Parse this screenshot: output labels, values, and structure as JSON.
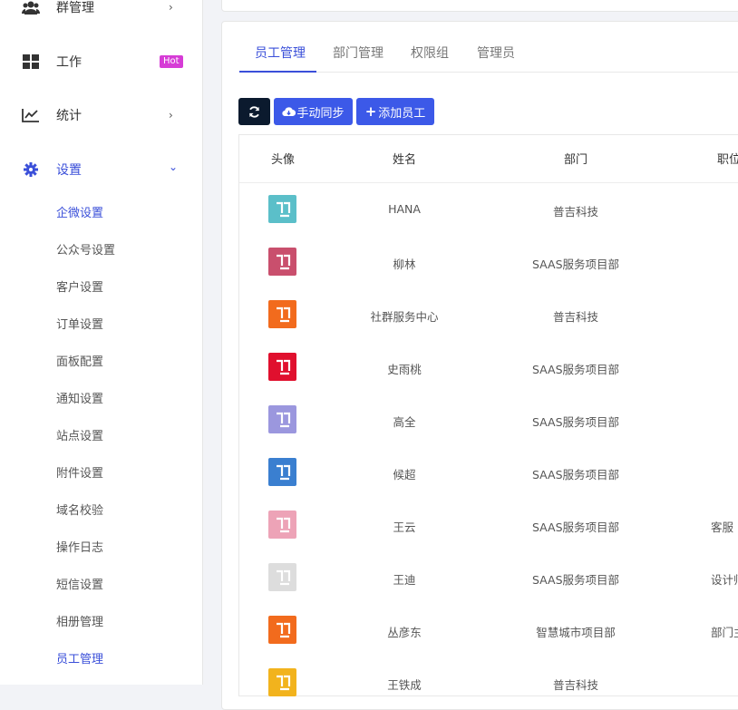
{
  "sidebar": {
    "items": [
      {
        "label": "群管理",
        "icon": "users-icon",
        "chevron": "›"
      },
      {
        "label": "工作",
        "icon": "grid-icon",
        "badge": "Hot"
      },
      {
        "label": "统计",
        "icon": "line-chart-icon",
        "chevron": "›"
      },
      {
        "label": "设置",
        "icon": "gear-icon",
        "chevron": "⌄"
      }
    ],
    "settings_submenu": [
      "企微设置",
      "公众号设置",
      "客户设置",
      "订单设置",
      "面板配置",
      "通知设置",
      "站点设置",
      "附件设置",
      "域名校验",
      "操作日志",
      "短信设置",
      "相册管理",
      "员工管理"
    ]
  },
  "tabs": [
    "员工管理",
    "部门管理",
    "权限组",
    "管理员"
  ],
  "toolbar": {
    "refresh_icon": "refresh-icon",
    "sync_label": "手动同步",
    "add_label": "添加员工"
  },
  "table": {
    "headers": [
      "头像",
      "姓名",
      "部门",
      "职位"
    ],
    "rows": [
      {
        "name": "HANA",
        "dept": "普吉科技",
        "position": "",
        "avatar_color": "#5bbfc9"
      },
      {
        "name": "柳林",
        "dept": "SAAS服务项目部",
        "position": "",
        "avatar_color": "#c94f6d"
      },
      {
        "name": "社群服务中心",
        "dept": "普吉科技",
        "position": "",
        "avatar_color": "#f26b1d"
      },
      {
        "name": "史雨桃",
        "dept": "SAAS服务项目部",
        "position": "",
        "avatar_color": "#e0102e"
      },
      {
        "name": "高全",
        "dept": "SAAS服务项目部",
        "position": "",
        "avatar_color": "#9b97de"
      },
      {
        "name": "候超",
        "dept": "SAAS服务项目部",
        "position": "",
        "avatar_color": "#3a7fd0"
      },
      {
        "name": "王云",
        "dept": "SAAS服务项目部",
        "position": "客服",
        "avatar_color": "#eda3b7"
      },
      {
        "name": "王迪",
        "dept": "SAAS服务项目部",
        "position": "设计师",
        "avatar_color": "#dddddd"
      },
      {
        "name": "丛彦东",
        "dept": "智慧城市项目部",
        "position": "部门主",
        "avatar_color": "#f26b1d"
      },
      {
        "name": "王铁成",
        "dept": "普吉科技",
        "position": "",
        "avatar_color": "#f2b31d"
      }
    ]
  },
  "colors": {
    "accent": "#3a4fd9",
    "button_primary": "#3c59e8",
    "button_dark": "#0b1a2e",
    "hot_badge": "#d63cd6"
  }
}
